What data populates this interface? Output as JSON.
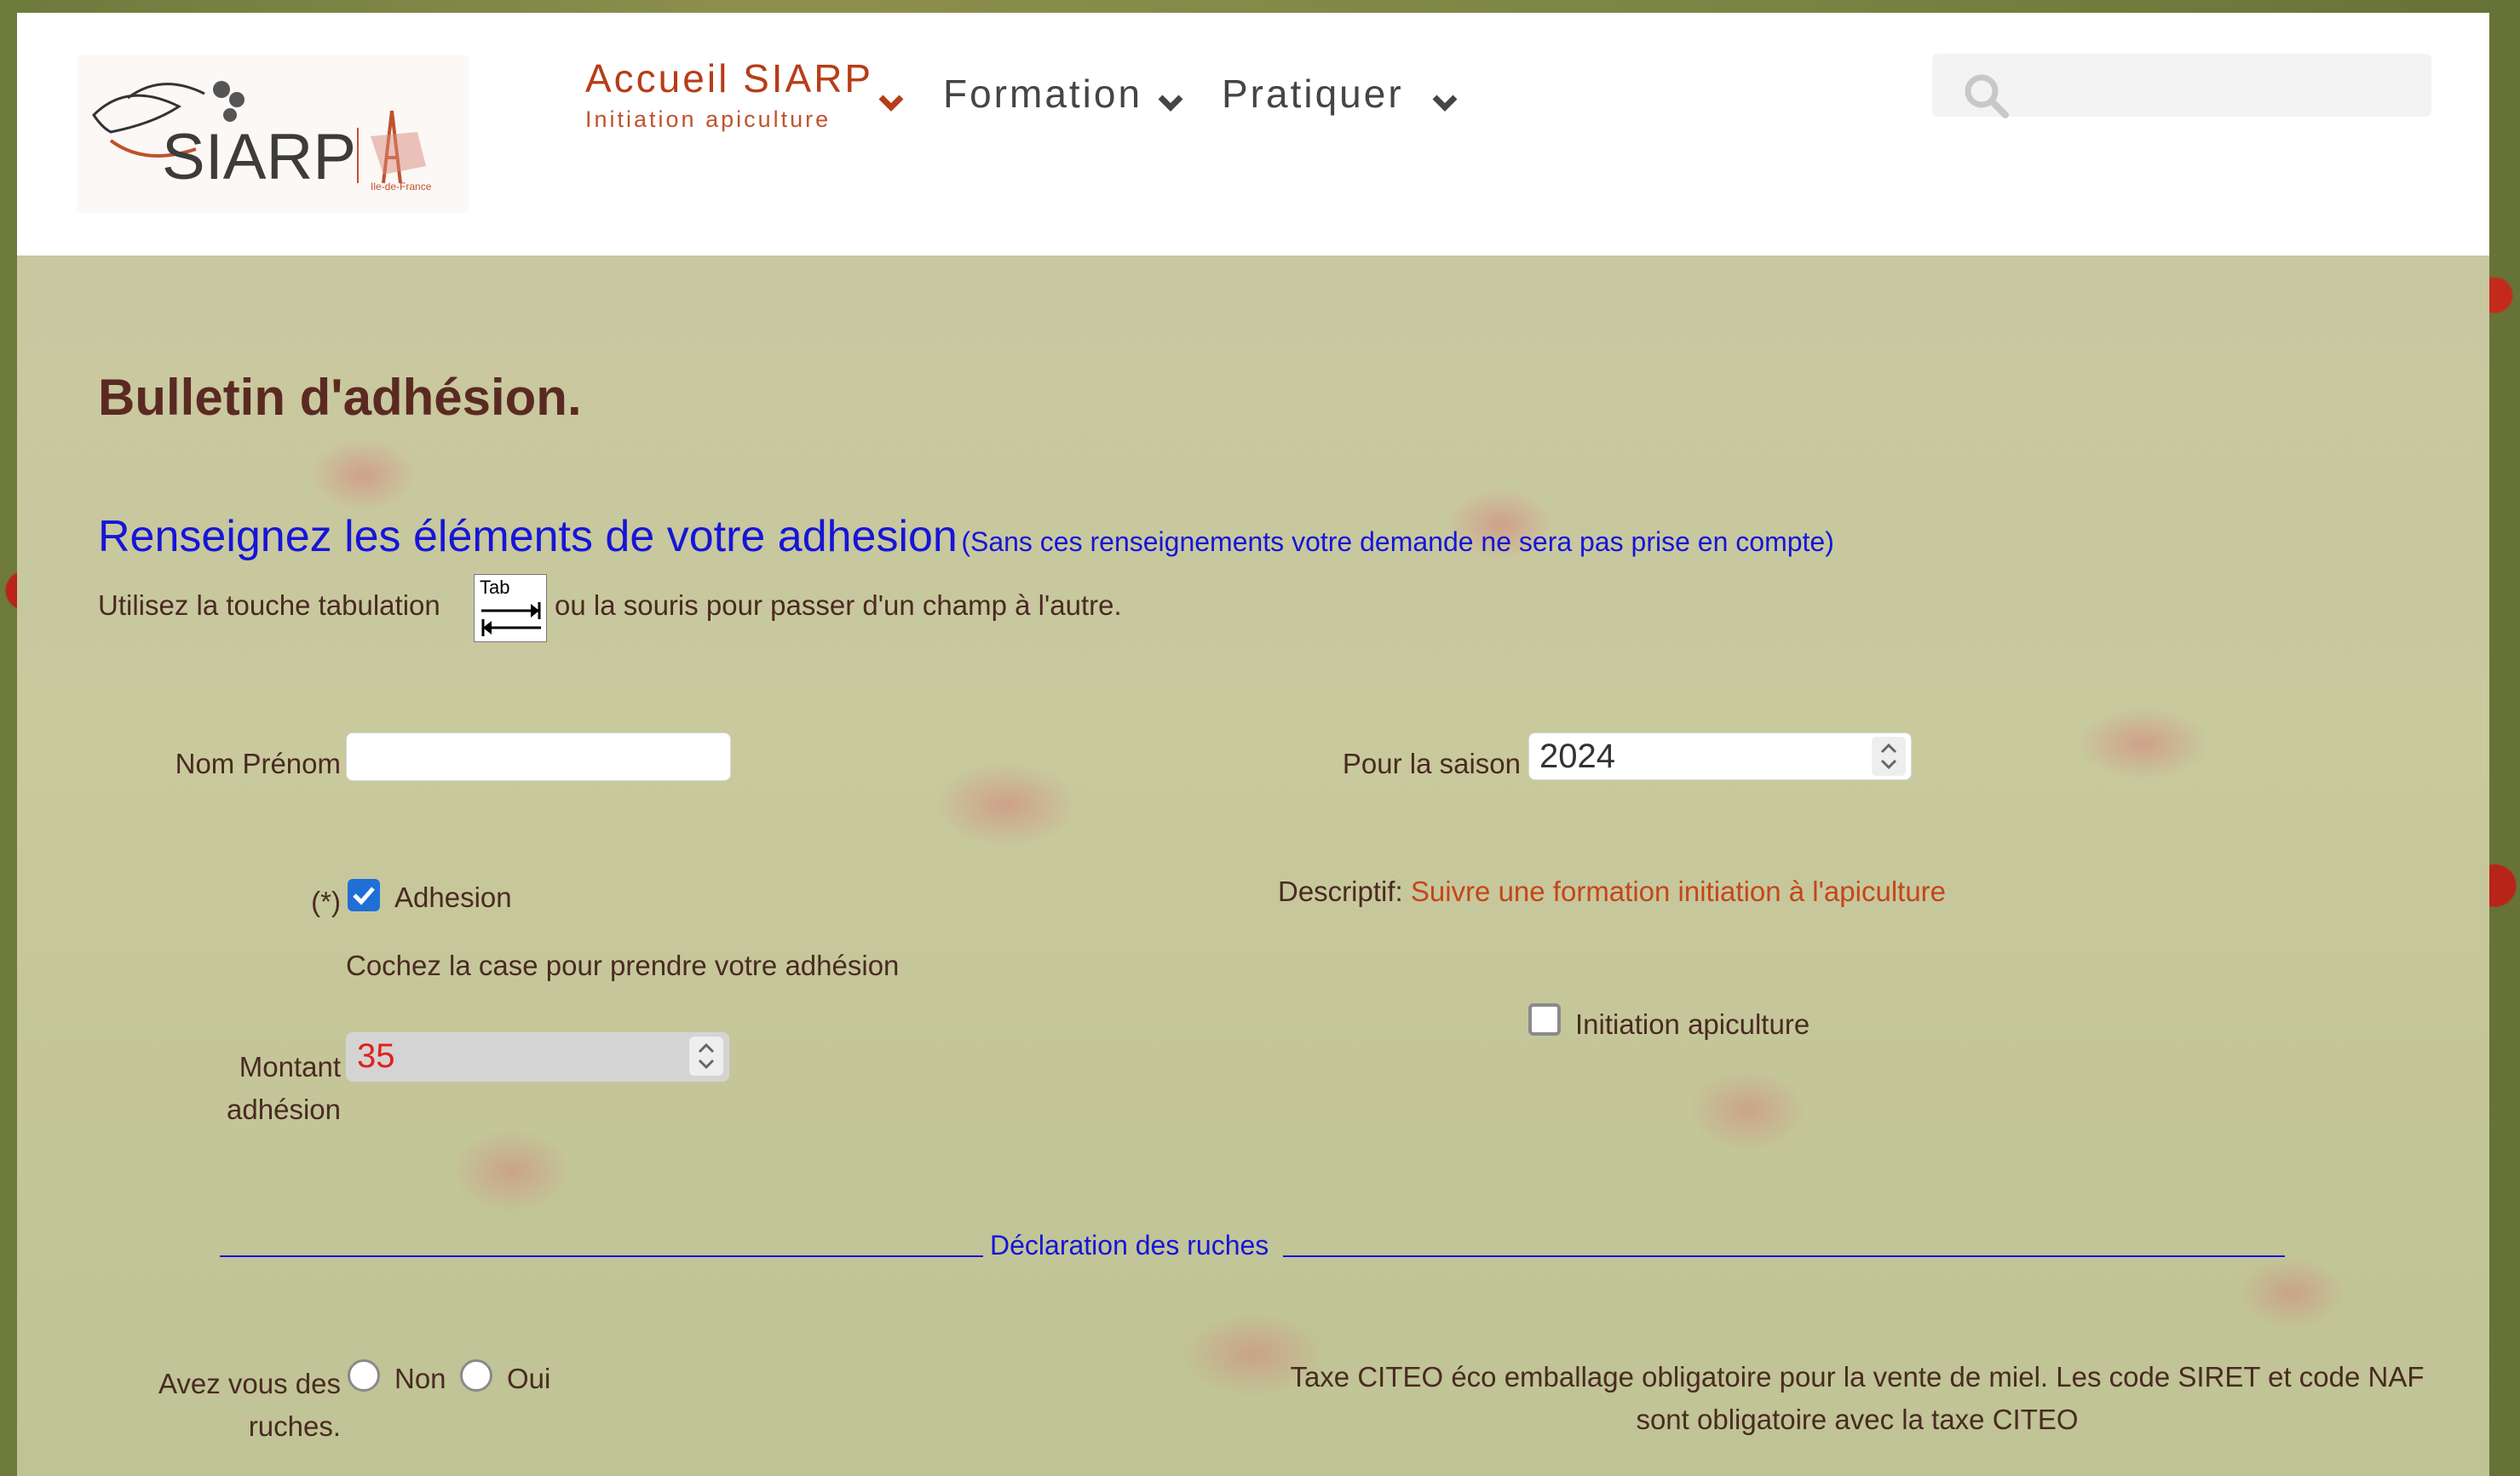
{
  "header": {
    "logo_text": "SIARP",
    "logo_sub": "Ile-de-France",
    "nav": [
      {
        "title": "Accueil SIARP",
        "subtitle": "Initiation apiculture"
      },
      {
        "title": "Formation"
      },
      {
        "title": "Pratiquer"
      }
    ],
    "search": {
      "placeholder": "",
      "icon": "search-icon"
    }
  },
  "form": {
    "title": "Bulletin d'adhésion.",
    "subtitle": "Renseignez les éléments de votre adhesion",
    "subtitle_note": "(Sans ces renseignements votre demande ne sera pas prise en compte)",
    "tab_hint_before": "Utilisez la touche tabulation",
    "tab_key_label": "Tab",
    "tab_hint_after": "ou la souris pour passer d'un champ à l'autre.",
    "nom_label": "Nom Prénom",
    "nom_value": "",
    "saison_label": "Pour la saison",
    "saison_value": "2024",
    "required_mark": "(*)",
    "adhesion_label": "Adhesion",
    "adhesion_checked": true,
    "adhesion_hint": "Cochez la case pour prendre votre adhésion",
    "descriptif_label": "Descriptif:",
    "descriptif_value": "Suivre une formation initiation à l'apiculture",
    "initiation_label": "Initiation apiculture",
    "initiation_checked": false,
    "montant_label_1": "Montant",
    "montant_label_2": "adhésion",
    "montant_value": "35",
    "section_title": "Déclaration des ruches",
    "ruches_label_1": "Avez vous des",
    "ruches_label_2": "ruches.",
    "radio_non": "Non",
    "radio_oui": "Oui",
    "citeo_line1": "Taxe CITEO éco emballage obligatoire pour la vente de miel. Les code SIRET et code NAF",
    "citeo_line2": "sont obligatoire avec la taxe CITEO"
  },
  "colors": {
    "accent": "#b73d18",
    "link_blue": "#1515d8",
    "title_brown": "#5a2a22",
    "checkbox_blue": "#1f6fd6"
  }
}
